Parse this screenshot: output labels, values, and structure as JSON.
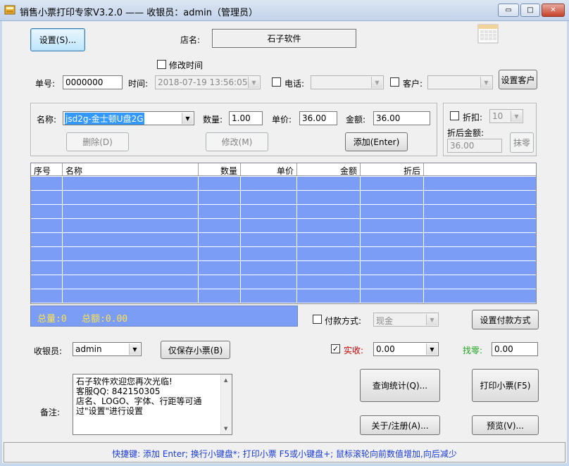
{
  "window": {
    "title": "销售小票打印专家V3.2.0 —— 收银员：admin（管理员）",
    "controls": {
      "minimize": "▭",
      "maximize": "□",
      "close": "✕"
    }
  },
  "top": {
    "settings_button": "设置(S)...",
    "shop_label": "店名:",
    "shop_name": "石子软件",
    "calendar_icon": "calendar-icon"
  },
  "order": {
    "modify_time_label": "修改时间",
    "modify_time_checked": false,
    "number_label": "单号:",
    "number_value": "0000000",
    "time_label": "时间:",
    "time_value": "2018-07-19 13:56:05",
    "phone_label": "电话:",
    "phone_checked": false,
    "phone_value": "",
    "customer_label": "客户:",
    "customer_checked": false,
    "customer_value": "",
    "set_customer_button": "设置客户"
  },
  "item": {
    "name_label": "名称:",
    "name_value": "jsd2g-金士顿U盘2G",
    "qty_label": "数量:",
    "qty_value": "1.00",
    "price_label": "单价:",
    "price_value": "36.00",
    "amount_label": "金额:",
    "amount_value": "36.00",
    "delete_button": "删除(D)",
    "modify_button": "修改(M)",
    "add_button": "添加(Enter)"
  },
  "discount": {
    "label": "折扣:",
    "checked": false,
    "value": "10",
    "after_label": "折后金额:",
    "after_value": "36.00",
    "round_button": "抹零"
  },
  "grid": {
    "columns": [
      "序号",
      "名称",
      "数量",
      "单价",
      "金额",
      "折后"
    ],
    "row_count": 9
  },
  "summary": {
    "total_qty": "总量:0",
    "total_amount": "总额:0.00"
  },
  "payment": {
    "label": "付款方式:",
    "checked": false,
    "value": "现金",
    "set_button": "设置付款方式"
  },
  "cashier": {
    "label": "收银员:",
    "value": "admin",
    "save_only_button": "仅保存小票(B)"
  },
  "receipt": {
    "received_label": "实收:",
    "received_checked": true,
    "received_value": "0.00",
    "change_label": "找零:",
    "change_value": "0.00"
  },
  "notes": {
    "label": "备注:",
    "text": "石子软件欢迎您再次光临!\n客服QQ: 842150305\n店名、LOGO、字体、行距等可通过\"设置\"进行设置"
  },
  "actions": {
    "query_button": "查询统计(Q)...",
    "print_button": "打印小票(F5)",
    "about_button": "关于/注册(A)...",
    "preview_button": "预览(V)..."
  },
  "status": {
    "text": "快捷键: 添加 Enter; 换行小键盘*; 打印小票 F5或小键盘+; 鼠标滚轮向前数值增加,向后减少"
  },
  "colors": {
    "grid_row": "#7b9df6",
    "summary_text": "#ffe44a",
    "received_label": "#d40000",
    "change_label": "#1fa31f",
    "status_text": "#1a3bd8"
  }
}
